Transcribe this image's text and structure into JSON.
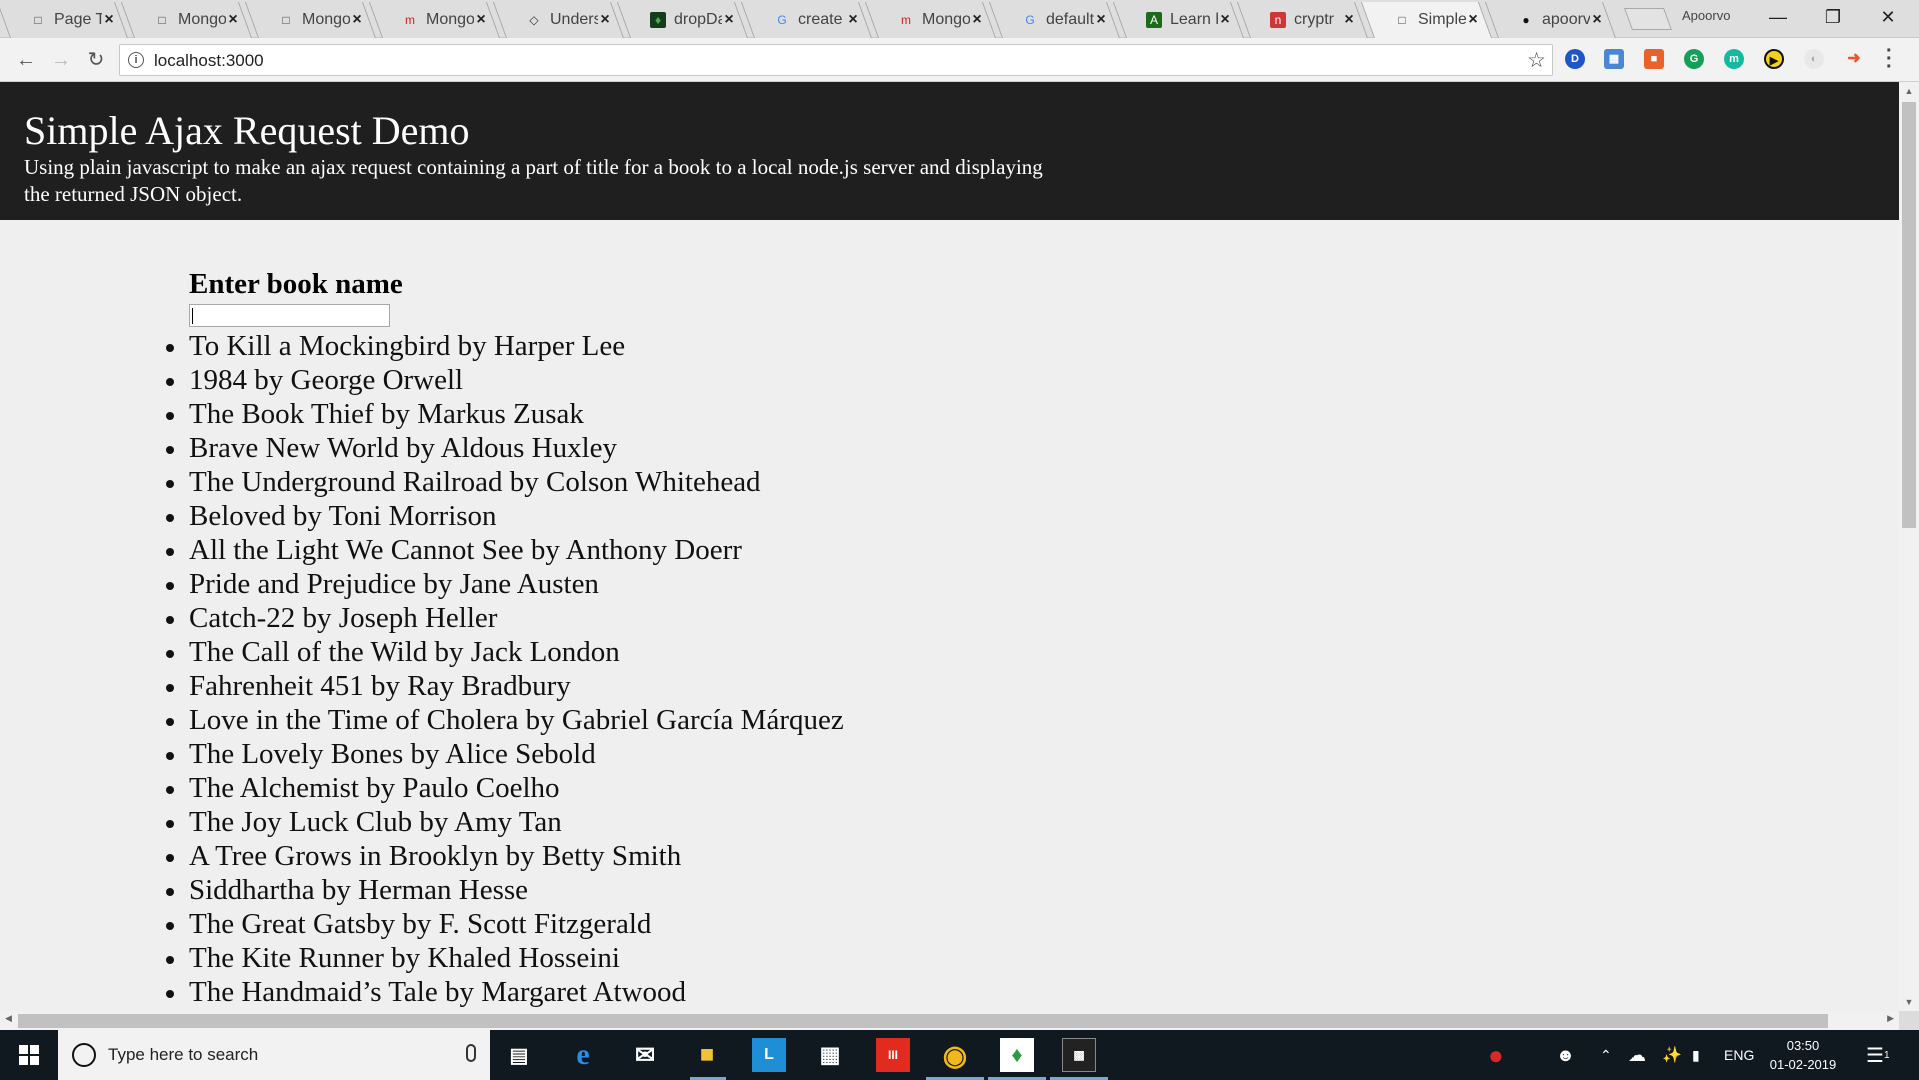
{
  "browser": {
    "tabs": [
      {
        "label": "Page Ti",
        "icon": "page-icon",
        "active": false
      },
      {
        "label": "Mongo",
        "icon": "page-icon",
        "active": false
      },
      {
        "label": "Mongo",
        "icon": "page-icon",
        "active": false
      },
      {
        "label": "Mongo",
        "icon": "mongo-m-icon",
        "active": false
      },
      {
        "label": "Unders",
        "icon": "diamond-icon",
        "active": false
      },
      {
        "label": "dropDa",
        "icon": "mongodb-leaf-icon",
        "active": false
      },
      {
        "label": "create",
        "icon": "google-icon",
        "active": false
      },
      {
        "label": "Mongo",
        "icon": "mongo-m-icon",
        "active": false
      },
      {
        "label": "default",
        "icon": "google-icon",
        "active": false
      },
      {
        "label": "Learn h",
        "icon": "learn-icon",
        "active": false
      },
      {
        "label": "cryptr",
        "icon": "npm-icon",
        "active": false
      },
      {
        "label": "Simple",
        "icon": "page-icon",
        "active": true
      },
      {
        "label": "apoorv",
        "icon": "github-icon",
        "active": false
      }
    ],
    "profile_name": "Apoorvo",
    "url": "localhost:3000"
  },
  "page": {
    "title": "Simple Ajax Request Demo",
    "description": "Using plain javascript to make an ajax request containing a part of title for a book to a local node.js server and displaying the returned JSON object.",
    "input_label": "Enter book name",
    "input_value": "",
    "books": [
      "To Kill a Mockingbird by Harper Lee",
      "1984 by George Orwell",
      "The Book Thief by Markus Zusak",
      "Brave New World by Aldous Huxley",
      "The Underground Railroad by Colson Whitehead",
      "Beloved by Toni Morrison",
      "All the Light We Cannot See by Anthony Doerr",
      "Pride and Prejudice by Jane Austen",
      "Catch-22 by Joseph Heller",
      "The Call of the Wild by Jack London",
      "Fahrenheit 451 by Ray Bradbury",
      "Love in the Time of Cholera by Gabriel García Márquez",
      "The Lovely Bones by Alice Sebold",
      "The Alchemist by Paulo Coelho",
      "The Joy Luck Club by Amy Tan",
      "A Tree Grows in Brooklyn by Betty Smith",
      "Siddhartha by Herman Hesse",
      "The Great Gatsby by F. Scott Fitzgerald",
      "The Kite Runner by Khaled Hosseini",
      "The Handmaid’s Tale by Margaret Atwood"
    ]
  },
  "taskbar": {
    "search_placeholder": "Type here to search",
    "language": "ENG",
    "time": "03:50",
    "date": "01-02-2019",
    "notification_count": "1"
  },
  "colors": {
    "header_bg": "#1f1f1f",
    "page_bg": "#efefef",
    "taskbar_bg": "#101820"
  }
}
